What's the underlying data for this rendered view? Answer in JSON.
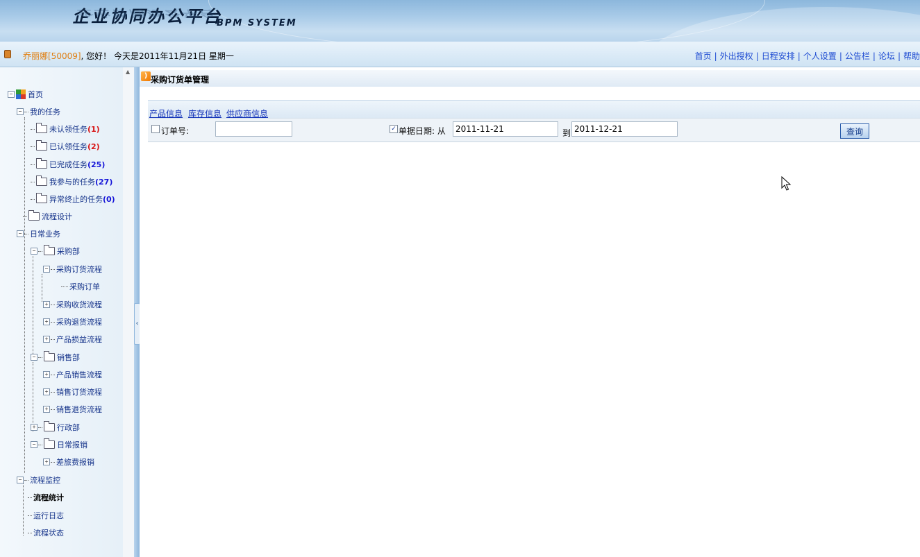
{
  "header": {
    "title": "企业协同办公平台",
    "subtitle": "BPM SYSTEM"
  },
  "infobar": {
    "user_name": "乔丽娜[50009]",
    "greeting_rest": ", 您好！ 今天是2011年11月21日 星期一",
    "nav_links": [
      "首页",
      "外出授权",
      "日程安排",
      "个人设置",
      "公告栏",
      "论坛",
      "帮助"
    ]
  },
  "sidebar": {
    "tree": {
      "home": "首页",
      "my_tasks": "我的任务",
      "unclaimed": "未认领任务",
      "unclaimed_count": "(1)",
      "claimed": "已认领任务",
      "claimed_count": "(2)",
      "completed": "已完成任务",
      "completed_count": "(25)",
      "participated": "我参与的任务",
      "participated_count": "(27)",
      "aborted": "异常终止的任务",
      "aborted_count": "(0)",
      "process_design": "流程设计",
      "daily_business": "日常业务",
      "purchasing_dept": "采购部",
      "purchase_order_flow": "采购订货流程",
      "purchase_order": "采购订单",
      "purchase_receive_flow": "采购收货流程",
      "purchase_return_flow": "采购退货流程",
      "product_loss_flow": "产品损益流程",
      "sales_dept": "销售部",
      "product_sales_flow": "产品销售流程",
      "sales_order_flow": "销售订货流程",
      "sales_return_flow": "销售退货流程",
      "admin_dept": "行政部",
      "daily_reimburse": "日常报销",
      "travel_reimburse": "差旅费报销",
      "process_monitor": "流程监控",
      "process_stats": "流程统计",
      "run_log": "运行日志",
      "process_status": "流程状态"
    }
  },
  "main": {
    "panel_title": "采购订货单管理",
    "tabs": [
      "产品信息",
      "库存信息",
      "供应商信息"
    ],
    "filter": {
      "order_no_label": "订单号:",
      "order_no_value": "",
      "date_label": "单据日期: 从",
      "date_from": "2011-11-21",
      "date_to_label": "到",
      "date_to": "2011-12-21",
      "order_no_checked": false,
      "date_checked": true,
      "search_button": "查询"
    }
  },
  "colors": {
    "link": "#1e4bd2",
    "username": "#e07f12",
    "count_red": "#d81515",
    "count_blue": "#1515d8"
  }
}
